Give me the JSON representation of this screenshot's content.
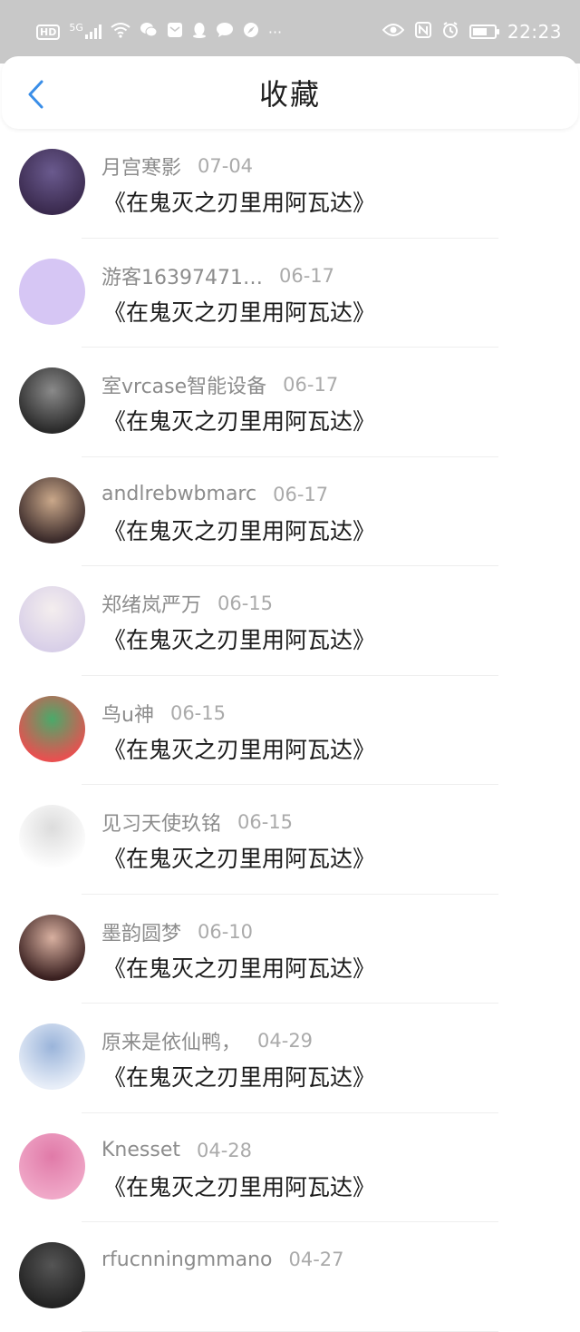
{
  "status_bar": {
    "hd": "HD",
    "network": "5G",
    "more": "···",
    "time": "22:23"
  },
  "header": {
    "title": "收藏"
  },
  "items": [
    {
      "name": "月宫寒影",
      "date": "07-04",
      "content": "《在鬼灭之刃里用阿瓦达》",
      "avatar_colors": [
        "#3a2a4e",
        "#6a5a8e"
      ]
    },
    {
      "name": "游客16397471…",
      "date": "06-17",
      "content": "《在鬼灭之刃里用阿瓦达》",
      "avatar_colors": [
        "#d6c6f4",
        "#d6c6f4"
      ]
    },
    {
      "name": "室vrcase智能设备",
      "date": "06-17",
      "content": "《在鬼灭之刃里用阿瓦达》",
      "avatar_colors": [
        "#2a2a2a",
        "#8a8a8a"
      ]
    },
    {
      "name": "andlrebwbmarc",
      "date": "06-17",
      "content": "《在鬼灭之刃里用阿瓦达》",
      "avatar_colors": [
        "#3a2a2a",
        "#caa88a"
      ]
    },
    {
      "name": "郑绪岚严万",
      "date": "06-15",
      "content": "《在鬼灭之刃里用阿瓦达》",
      "avatar_colors": [
        "#d8cfe8",
        "#f4eeee"
      ]
    },
    {
      "name": "鸟u神",
      "date": "06-15",
      "content": "《在鬼灭之刃里用阿瓦达》",
      "avatar_colors": [
        "#e85050",
        "#4aaa6a"
      ]
    },
    {
      "name": "见习天使玖铭",
      "date": "06-15",
      "content": "《在鬼灭之刃里用阿瓦达》",
      "avatar_colors": [
        "#ffffff",
        "#dcdcdc"
      ]
    },
    {
      "name": "墨韵圆梦",
      "date": "06-10",
      "content": "《在鬼灭之刃里用阿瓦达》",
      "avatar_colors": [
        "#3a2020",
        "#d8b0a0"
      ]
    },
    {
      "name": "  原来是依仙鸭，",
      "date": "04-29",
      "content": "《在鬼灭之刃里用阿瓦达》",
      "avatar_colors": [
        "#e8eef8",
        "#9ab4da"
      ]
    },
    {
      "name": "Knesset",
      "date": "04-28",
      "content": "《在鬼灭之刃里用阿瓦达》",
      "avatar_colors": [
        "#f0a8c8",
        "#e07aa8"
      ]
    },
    {
      "name": "rfucnningmmano",
      "date": "04-27",
      "content": "",
      "avatar_colors": [
        "#222222",
        "#555555"
      ]
    }
  ]
}
